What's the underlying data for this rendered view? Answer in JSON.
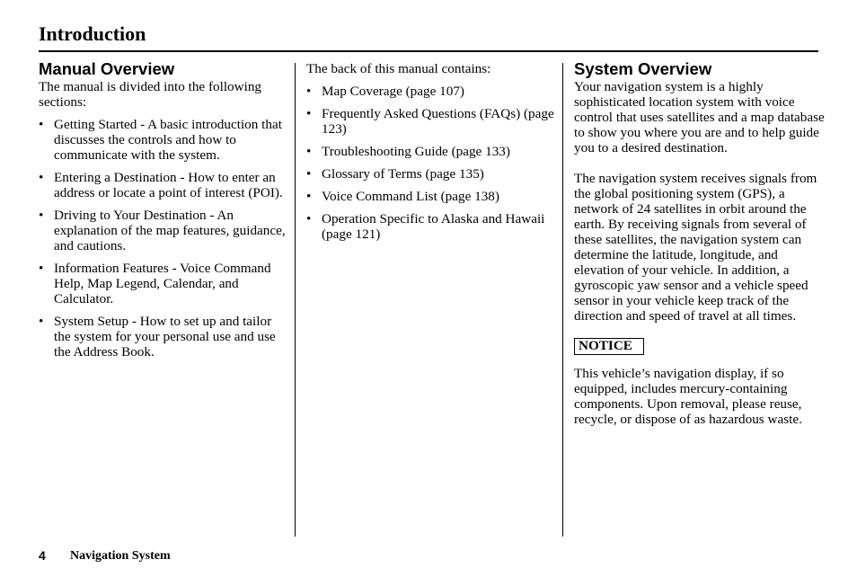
{
  "header": {
    "title": "Introduction"
  },
  "manual_overview": {
    "heading": "Manual Overview",
    "intro": "The manual is divided into the following sections:",
    "bullet_glyph": "•",
    "items": [
      "Getting Started - A basic introduction that discusses the controls and how to communicate with the system.",
      "Entering a Destination - How to enter an address or locate a point of interest (POI).",
      "Driving to Your Destination - An explanation of the map features, guidance, and cautions.",
      "Information Features - Voice Command Help, Map Legend, Calendar, and Calculator.",
      "System Setup - How to set up and tailor the system for your personal use and use the Address Book."
    ]
  },
  "back_of_manual": {
    "intro": "The back of this manual contains:",
    "items": [
      "Map Coverage (page 107)",
      "Frequently Asked Questions (FAQs) (page 123)",
      "Troubleshooting Guide (page 133)",
      "Glossary of Terms (page 135)",
      "Voice Command List (page 138)",
      "Operation Specific to Alaska and Hawaii (page 121)"
    ]
  },
  "system_overview": {
    "heading": "System Overview",
    "paragraphs": [
      "Your navigation system is a highly sophisticated location system with voice control that uses satellites and a map database to show you where you are and to help guide you to a desired destination.",
      "The navigation system receives signals from the global positioning system (GPS), a network of 24 satellites in orbit around the earth. By receiving signals from several of these satellites, the navigation system can determine the latitude, longitude, and elevation of your vehicle. In addition, a gyroscopic yaw sensor and a vehicle speed sensor in your vehicle keep track of the direction and speed of travel at all times."
    ],
    "notice_label": "NOTICE",
    "notice_text": "This vehicle’s navigation display, if so equipped, includes mercury-containing components. Upon removal, please reuse, recycle, or dispose of as hazardous waste."
  },
  "footer": {
    "page_number": "4",
    "title": "Navigation System"
  }
}
